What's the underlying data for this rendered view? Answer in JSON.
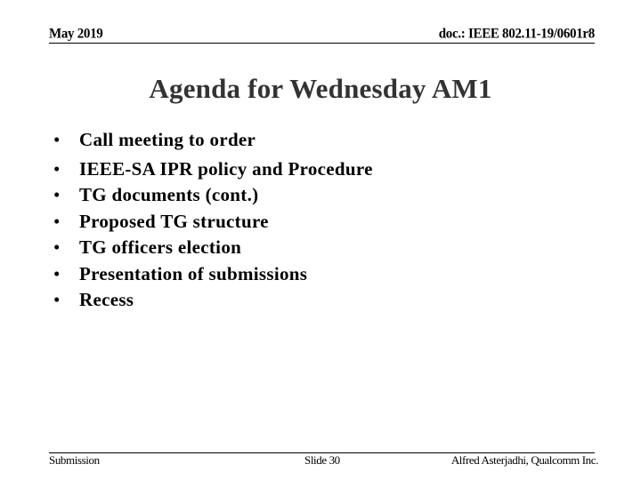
{
  "header": {
    "date": "May 2019",
    "doc_id": "doc.: IEEE 802.11-19/0601r8"
  },
  "slide": {
    "title": "Agenda for Wednesday AM1",
    "bullet_glyph": "•",
    "items": [
      "Call meeting to order",
      "IEEE-SA IPR policy and Procedure",
      "TG documents (cont.)",
      "Proposed TG structure",
      "TG officers election",
      "Presentation of submissions",
      "Recess"
    ]
  },
  "footer": {
    "left": "Submission",
    "center": "Slide 30",
    "right": "Alfred Asterjadhi, Qualcomm Inc."
  },
  "colors": {
    "title": "#333333",
    "text": "#000000",
    "background": "#ffffff"
  }
}
